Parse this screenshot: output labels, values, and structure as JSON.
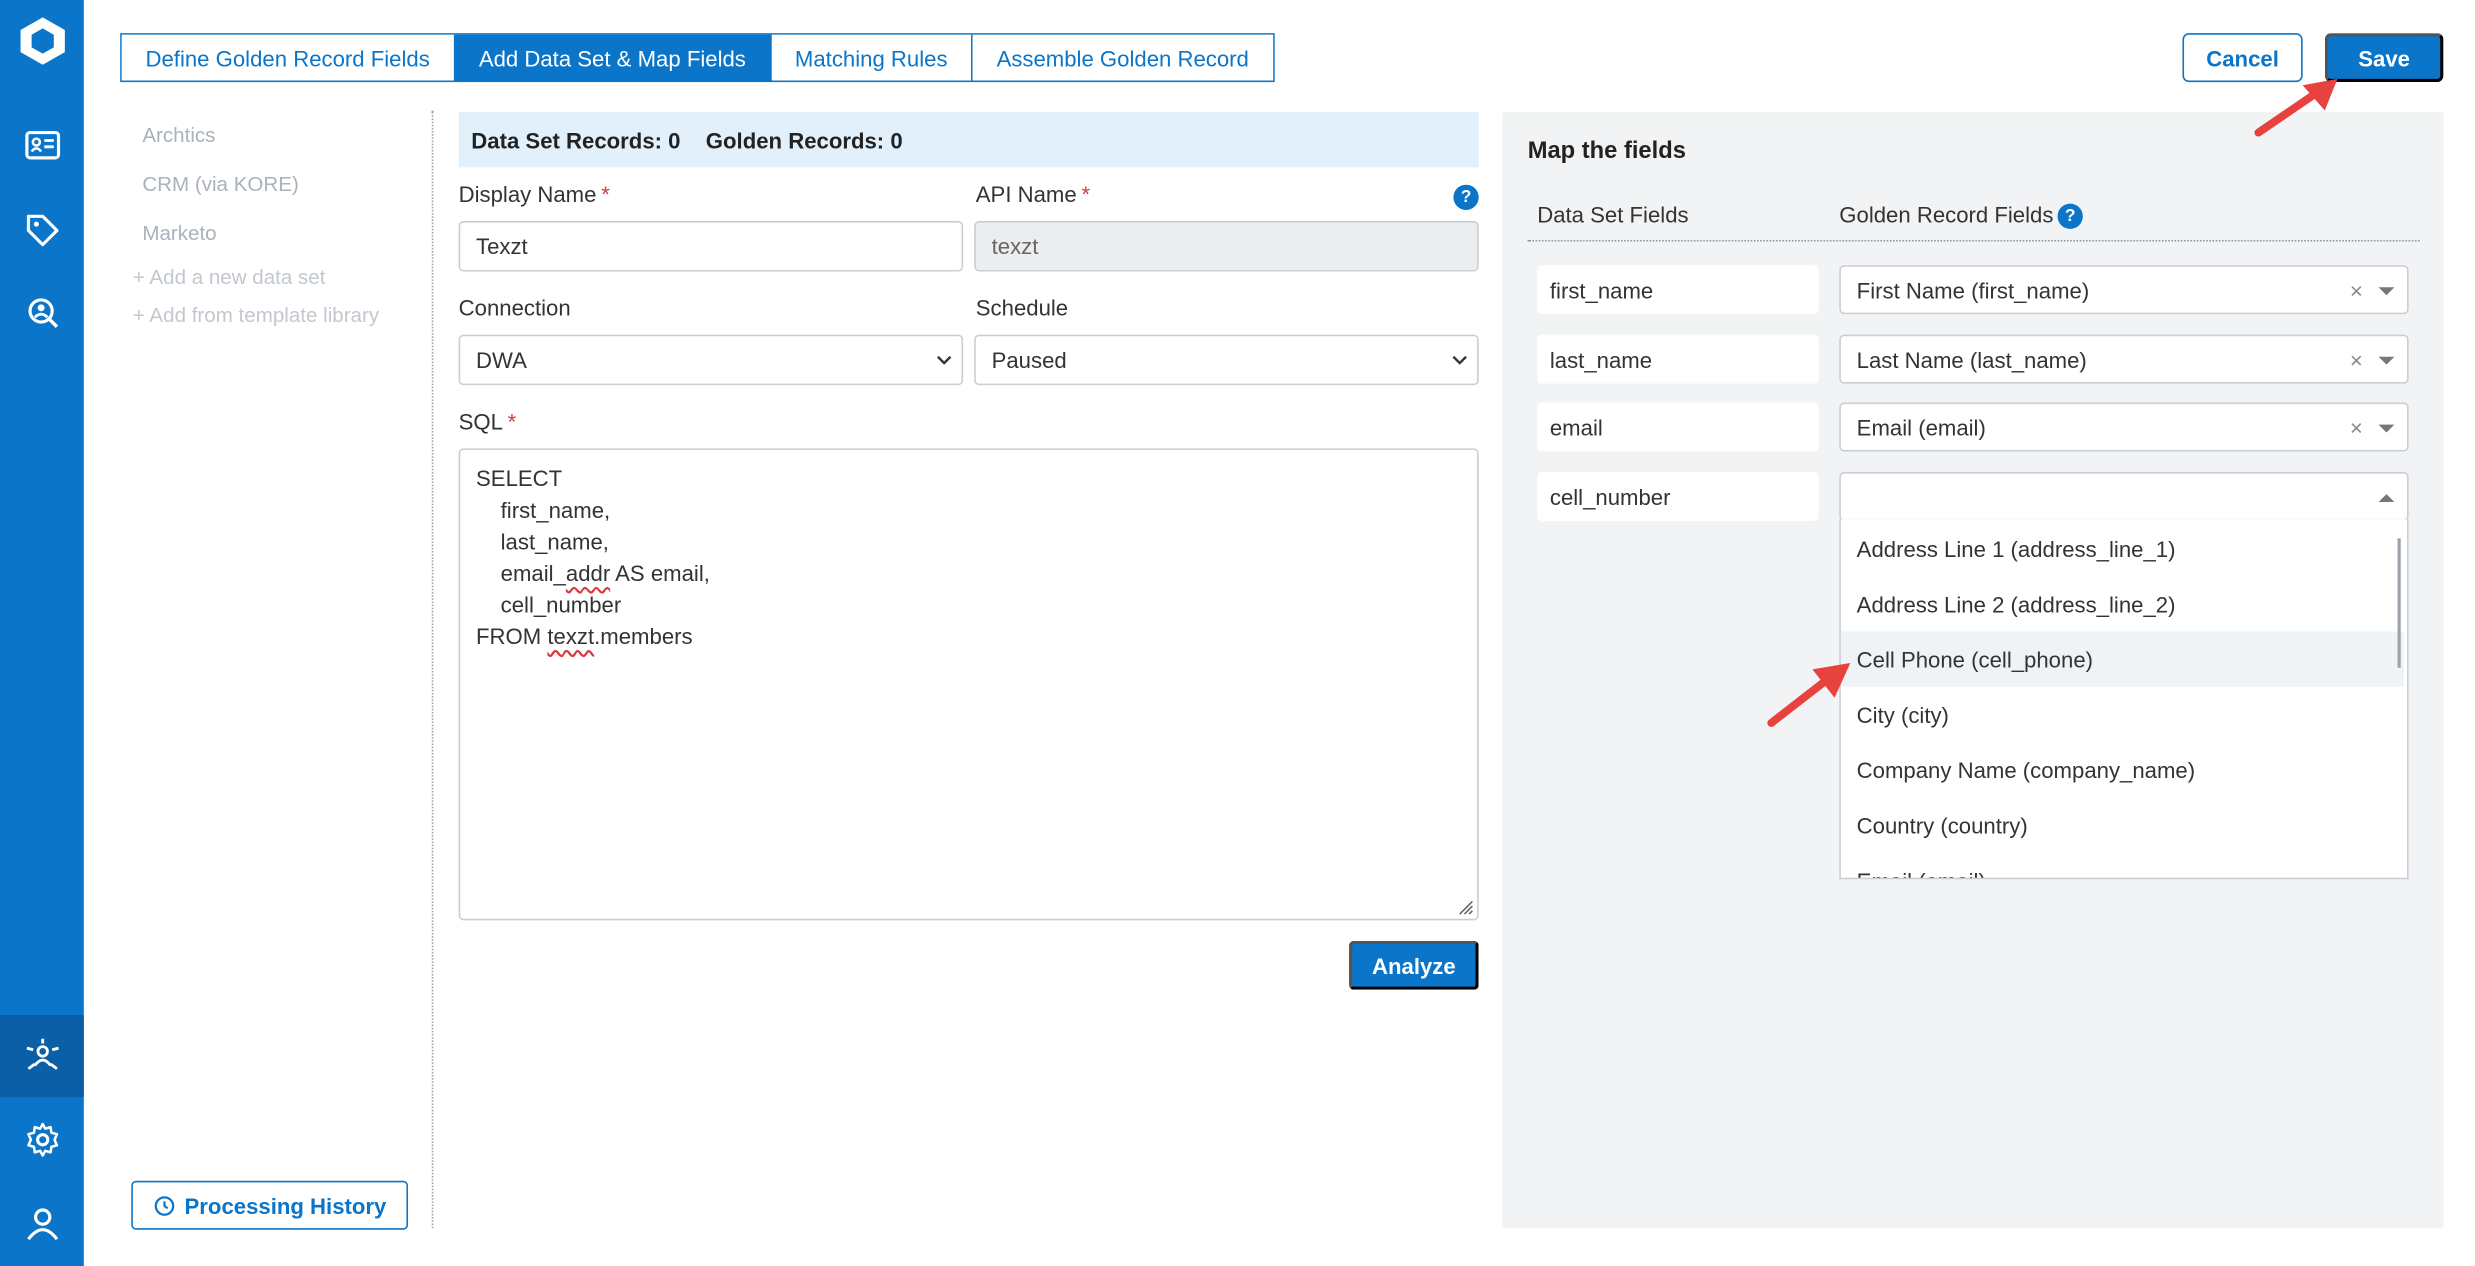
{
  "tabs": [
    {
      "label": "Define Golden Record Fields"
    },
    {
      "label": "Add Data Set & Map Fields"
    },
    {
      "label": "Matching Rules"
    },
    {
      "label": "Assemble Golden Record"
    }
  ],
  "header": {
    "cancel_label": "Cancel",
    "save_label": "Save"
  },
  "datasets": {
    "items": [
      "Archtics",
      "CRM (via KORE)",
      "Marketo"
    ],
    "add_new": "+ Add a new data set",
    "add_template": "+ Add from template library",
    "history_label": "Processing History"
  },
  "form": {
    "banner": {
      "dataset_records": "Data Set Records: 0",
      "golden_records": "Golden Records: 0"
    },
    "display_name_label": "Display Name",
    "display_name_value": "Texzt",
    "api_name_label": "API Name",
    "api_name_value": "texzt",
    "connection_label": "Connection",
    "connection_value": "DWA",
    "schedule_label": "Schedule",
    "schedule_value": "Paused",
    "sql_label": "SQL",
    "sql_lines": {
      "l1": "SELECT",
      "l2": "    first_name,",
      "l3": "    last_name,",
      "l4a": "    email_",
      "l4b": "addr",
      "l4c": " AS email,",
      "l5": "    cell_number",
      "l6a": "FROM ",
      "l6b": "texzt",
      "l6c": ".members"
    },
    "analyze_label": "Analyze",
    "required_mark": "*"
  },
  "mapping": {
    "title": "Map the fields",
    "col_dataset": "Data Set Fields",
    "col_golden": "Golden Record Fields",
    "rows": [
      {
        "field": "first_name",
        "golden": "First Name (first_name)"
      },
      {
        "field": "last_name",
        "golden": "Last Name (last_name)"
      },
      {
        "field": "email",
        "golden": "Email (email)"
      },
      {
        "field": "cell_number",
        "golden": ""
      }
    ],
    "clear_glyph": "×",
    "dropdown_options": [
      "Address Line 1 (address_line_1)",
      "Address Line 2 (address_line_2)",
      "Cell Phone (cell_phone)",
      "City (city)",
      "Company Name (company_name)",
      "Country (country)",
      "Email (email)"
    ],
    "highlighted_option": "Cell Phone (cell_phone)"
  },
  "help_glyph": "?",
  "colors": {
    "primary": "#0a75c9",
    "rail": "#0a75c9",
    "annotation_arrow": "#e8423f"
  }
}
